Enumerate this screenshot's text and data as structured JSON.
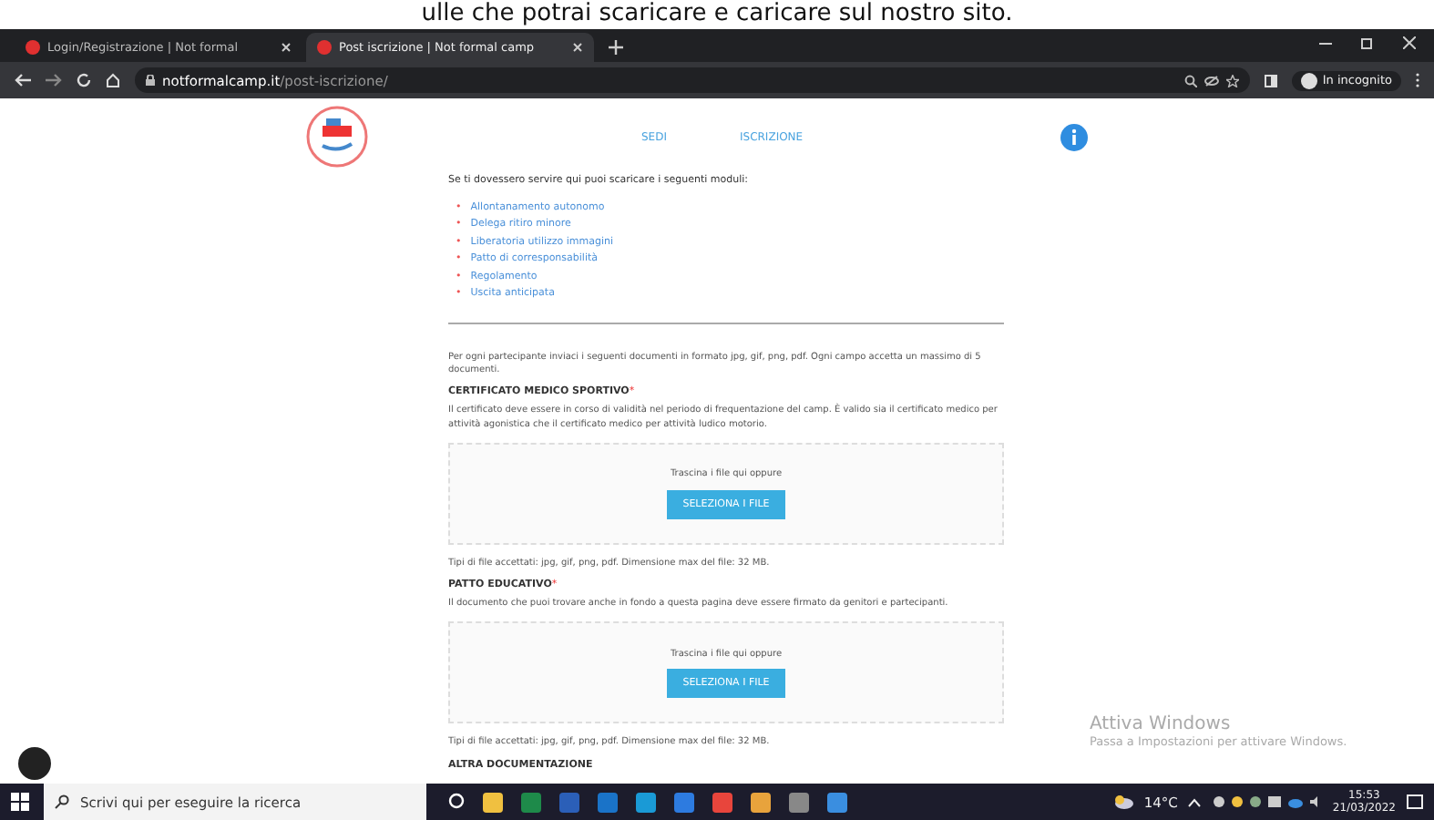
{
  "caption": "ulle che potrai scaricare e caricare sul nostro sito.",
  "browser": {
    "tabs": [
      {
        "title": "Login/Registrazione | Not formal",
        "selected": false
      },
      {
        "title": "Post iscrizione | Not formal camp",
        "selected": true
      }
    ],
    "url_domain": "notformalcamp.it",
    "url_path": "/post-iscrizione/",
    "incognito_label": "In incognito"
  },
  "nav": [
    "SEDI",
    "ISCRIZIONE"
  ],
  "modules_intro": "Se ti dovessero servire qui puoi scaricare i seguenti moduli:",
  "modules": [
    {
      "bullet": "•",
      "label": "Allontanamento autonomo"
    },
    {
      "bullet": "•",
      "label": "Delega ritiro minore"
    },
    {
      "bullet": "•",
      "label": "Liberatoria utilizzo immagini"
    },
    {
      "bullet": "•",
      "label": "Patto di corresponsabilità"
    },
    {
      "bullet": "•",
      "label": "Regolamento"
    },
    {
      "bullet": "•",
      "label": "Uscita anticipata"
    }
  ],
  "instructions": "Per ogni partecipante inviaci i seguenti documenti in formato jpg, gif, png, pdf. Ogni campo accetta un massimo di 5 documenti.",
  "uploads": [
    {
      "title": "CERTIFICATO MEDICO SPORTIVO",
      "required_mark": "*",
      "description": "Il certificato deve essere in corso di validità nel periodo di frequentazione del camp. È valido sia il certificato medico per attività agonistica che il certificato medico per attività ludico motorio.",
      "drop_hint": "Trascina i file qui oppure",
      "button": "SELEZIONA I FILE",
      "file_types": "Tipi di file accettati: jpg, gif, png, pdf. Dimensione max del file: 32 MB."
    },
    {
      "title": "PATTO EDUCATIVO",
      "required_mark": "*",
      "description": "Il documento che puoi trovare anche in fondo a questa pagina deve essere firmato da genitori e partecipanti.",
      "drop_hint": "Trascina i file qui oppure",
      "button": "SELEZIONA I FILE",
      "file_types": "Tipi di file accettati: jpg, gif, png, pdf. Dimensione max del file: 32 MB."
    }
  ],
  "next_section": "ALTRA DOCUMENTAZIONE",
  "watermark": {
    "title": "Attiva Windows",
    "subtitle": "Passa a Impostazioni per attivare Windows."
  },
  "taskbar": {
    "search_placeholder": "Scrivi qui per eseguire la ricerca",
    "weather": "14°C",
    "time": "15:53",
    "date": "21/03/2022"
  }
}
